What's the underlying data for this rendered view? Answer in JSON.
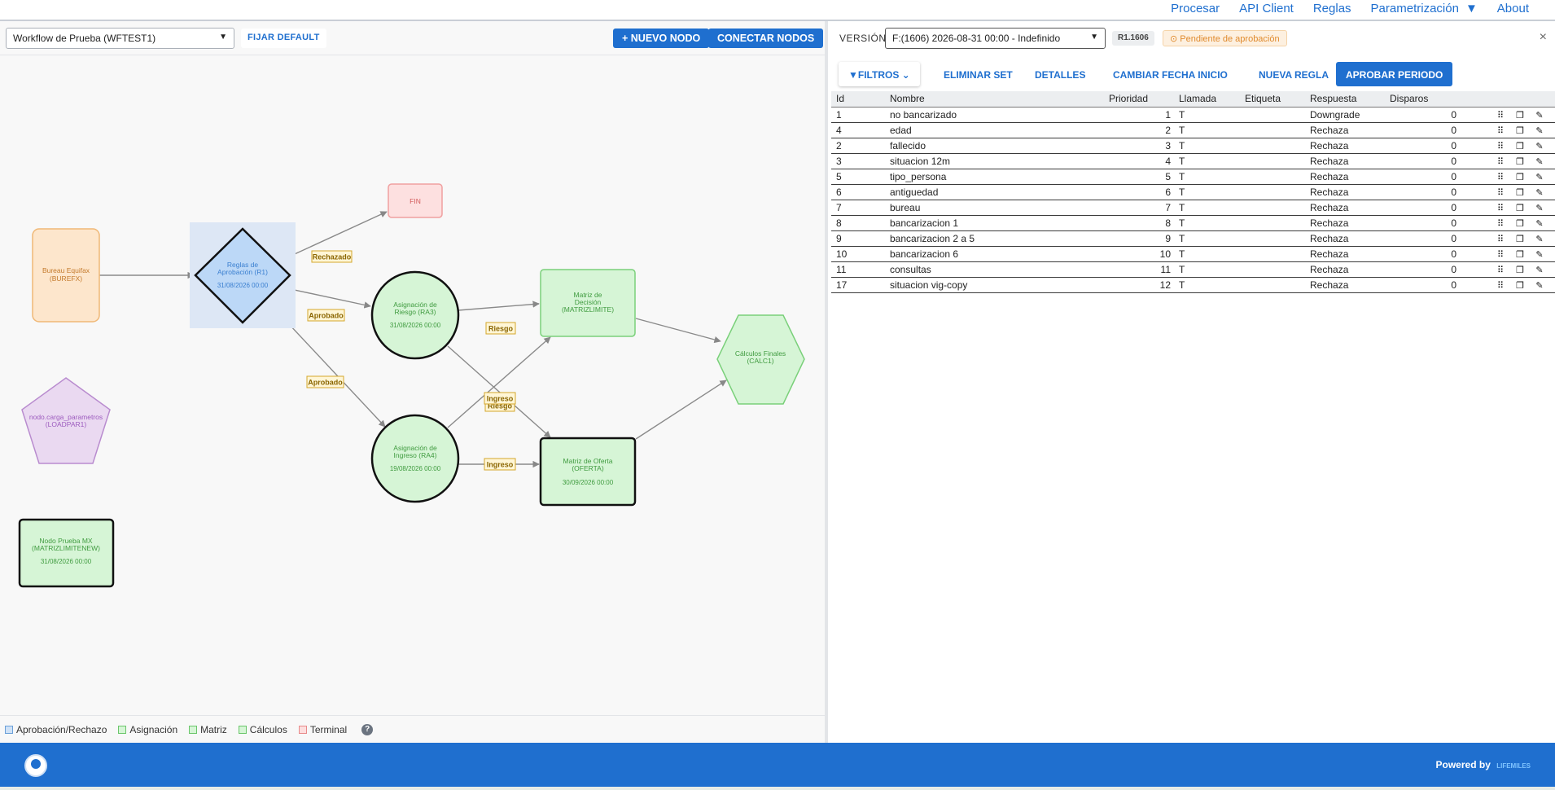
{
  "nav": {
    "links": [
      "Procesar",
      "API Client",
      "Reglas",
      "Parametrización",
      "About"
    ]
  },
  "left_toolbar": {
    "workflow_select": "Workflow de Prueba (WFTEST1)",
    "fijar_default": "FIJAR DEFAULT",
    "nuevo_nodo": "+ NUEVO NODO",
    "conectar_nodos": "CONECTAR NODOS"
  },
  "graph": {
    "nodes": [
      {
        "id": "burefx",
        "shape": "rounded-rect",
        "kind": "input",
        "lines": [
          "Bureau Equifax",
          "(BUREFX)"
        ],
        "date": ""
      },
      {
        "id": "r1",
        "shape": "diamond",
        "kind": "aprobacion",
        "lines": [
          "Reglas de",
          "Aprobación (R1)"
        ],
        "date": "31/08/2026 00:00",
        "selected": true
      },
      {
        "id": "fin",
        "shape": "rect",
        "kind": "terminal",
        "lines": [
          "FIN"
        ],
        "date": ""
      },
      {
        "id": "ra3",
        "shape": "circle",
        "kind": "asignacion",
        "lines": [
          "Asignación de",
          "Riesgo (RA3)"
        ],
        "date": "31/08/2026 00:00"
      },
      {
        "id": "ra4",
        "shape": "circle",
        "kind": "asignacion",
        "lines": [
          "Asignación de",
          "Ingreso (RA4)"
        ],
        "date": "19/08/2026 00:00"
      },
      {
        "id": "matrizlimite",
        "shape": "rect",
        "kind": "matriz",
        "lines": [
          "Matriz de",
          "Decisión",
          "(MATRIZLIMITE)"
        ],
        "date": ""
      },
      {
        "id": "oferta",
        "shape": "rect",
        "kind": "matriz-bold",
        "lines": [
          "Matriz de Oferta",
          "(OFERTA)"
        ],
        "date": "30/09/2026 00:00"
      },
      {
        "id": "calc1",
        "shape": "hexagon",
        "kind": "calculos",
        "lines": [
          "Cálculos Finales",
          "(CALC1)"
        ],
        "date": ""
      },
      {
        "id": "loadpar1",
        "shape": "pentagon",
        "kind": "carga",
        "lines": [
          "nodo.carga_parametros",
          "(LOADPAR1)"
        ],
        "date": ""
      },
      {
        "id": "matrizlimitenew",
        "shape": "rect",
        "kind": "matriz-bold",
        "lines": [
          "Nodo Prueba MX",
          "(MATRIZLIMITENEW)"
        ],
        "date": "31/08/2026 00:00"
      }
    ],
    "edge_labels": [
      "Rechazado",
      "Aprobado",
      "Aprobado",
      "Riesgo",
      "Ingreso",
      "Riesgo",
      "Ingreso"
    ]
  },
  "legend": {
    "items": [
      {
        "label": "Aprobación/Rechazo",
        "color": "#cfe2f7",
        "border": "#6a9fd8"
      },
      {
        "label": "Asignación",
        "color": "#d6f5d6",
        "border": "#6ac66a"
      },
      {
        "label": "Matriz",
        "color": "#d6f5d6",
        "border": "#6ac66a"
      },
      {
        "label": "Cálculos",
        "color": "#d6f5d6",
        "border": "#6ac66a"
      },
      {
        "label": "Terminal",
        "color": "#fddede",
        "border": "#e88a8a"
      }
    ],
    "help": "?"
  },
  "right_panel": {
    "version_label": "VERSIÓN",
    "version_select": "F:(1606) 2026-08-31 00:00 - Indefinido",
    "release_badge": "R1.1606",
    "status_badge": "Pendiente de aprobación",
    "close": "×",
    "tabs": {
      "filtros": "FILTROS",
      "eliminar_set": "ELIMINAR SET",
      "detalles": "DETALLES",
      "cambiar_fecha": "CAMBIAR FECHA INICIO",
      "nueva_regla": "NUEVA REGLA",
      "aprobar_periodo": "APROBAR PERIODO"
    },
    "table": {
      "headers": [
        "Id",
        "Nombre",
        "Prioridad",
        "Llamada",
        "Etiqueta",
        "Respuesta",
        "Disparos"
      ],
      "rows": [
        {
          "id": "1",
          "nombre": "no bancarizado",
          "prioridad": "1",
          "llamada": "T",
          "etiqueta": "",
          "respuesta": "Downgrade",
          "disparos": "0"
        },
        {
          "id": "4",
          "nombre": "edad",
          "prioridad": "2",
          "llamada": "T",
          "etiqueta": "",
          "respuesta": "Rechaza",
          "disparos": "0"
        },
        {
          "id": "2",
          "nombre": "fallecido",
          "prioridad": "3",
          "llamada": "T",
          "etiqueta": "",
          "respuesta": "Rechaza",
          "disparos": "0"
        },
        {
          "id": "3",
          "nombre": "situacion 12m",
          "prioridad": "4",
          "llamada": "T",
          "etiqueta": "",
          "respuesta": "Rechaza",
          "disparos": "0"
        },
        {
          "id": "5",
          "nombre": "tipo_persona",
          "prioridad": "5",
          "llamada": "T",
          "etiqueta": "",
          "respuesta": "Rechaza",
          "disparos": "0"
        },
        {
          "id": "6",
          "nombre": "antiguedad",
          "prioridad": "6",
          "llamada": "T",
          "etiqueta": "",
          "respuesta": "Rechaza",
          "disparos": "0"
        },
        {
          "id": "7",
          "nombre": "bureau",
          "prioridad": "7",
          "llamada": "T",
          "etiqueta": "",
          "respuesta": "Rechaza",
          "disparos": "0"
        },
        {
          "id": "8",
          "nombre": "bancarizacion 1",
          "prioridad": "8",
          "llamada": "T",
          "etiqueta": "",
          "respuesta": "Rechaza",
          "disparos": "0"
        },
        {
          "id": "9",
          "nombre": "bancarizacion 2 a 5",
          "prioridad": "9",
          "llamada": "T",
          "etiqueta": "",
          "respuesta": "Rechaza",
          "disparos": "0"
        },
        {
          "id": "10",
          "nombre": "bancarizacion 6",
          "prioridad": "10",
          "llamada": "T",
          "etiqueta": "",
          "respuesta": "Rechaza",
          "disparos": "0"
        },
        {
          "id": "11",
          "nombre": "consultas",
          "prioridad": "11",
          "llamada": "T",
          "etiqueta": "",
          "respuesta": "Rechaza",
          "disparos": "0"
        },
        {
          "id": "17",
          "nombre": "situacion vig-copy",
          "prioridad": "12",
          "llamada": "T",
          "etiqueta": "",
          "respuesta": "Rechaza",
          "disparos": "0"
        }
      ]
    }
  },
  "footer": {
    "powered_by": "Powered by",
    "brand": "LIFEMILES"
  }
}
